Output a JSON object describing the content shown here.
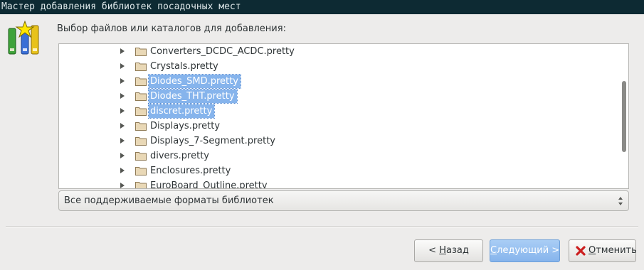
{
  "window": {
    "title": "Мастер добавления библиотек посадочных мест"
  },
  "prompt": "Выбор файлов или каталогов для добавления:",
  "files": [
    {
      "label": "Converters_DCDC_ACDC.pretty",
      "selected": false
    },
    {
      "label": "Crystals.pretty",
      "selected": false
    },
    {
      "label": "Diodes_SMD.pretty",
      "selected": true
    },
    {
      "label": "Diodes_THT.pretty",
      "selected": true
    },
    {
      "label": "discret.pretty",
      "selected": true
    },
    {
      "label": "Displays.pretty",
      "selected": false
    },
    {
      "label": "Displays_7-Segment.pretty",
      "selected": false
    },
    {
      "label": "divers.pretty",
      "selected": false
    },
    {
      "label": "Enclosures.pretty",
      "selected": false
    },
    {
      "label": "EuroBoard_Outline.pretty",
      "selected": false
    }
  ],
  "filter": {
    "selected": "Все поддерживаемые форматы библиотек"
  },
  "buttons": {
    "back": {
      "pre": "< ",
      "mnemonic": "Н",
      "rest": "азад"
    },
    "next": {
      "pre": "",
      "mnemonic": "С",
      "rest": "ледующий >"
    },
    "cancel": {
      "pre": "",
      "mnemonic": "О",
      "rest": "тменить"
    }
  },
  "icons": {
    "logo": "library-wizard-icon",
    "folder": "folder-icon",
    "expander": "expander-arrow-icon",
    "cancel": "cancel-x-icon"
  },
  "colors": {
    "selection": "#86b4ec",
    "titlebar": "#0d2a33",
    "background": "#edeceb"
  }
}
